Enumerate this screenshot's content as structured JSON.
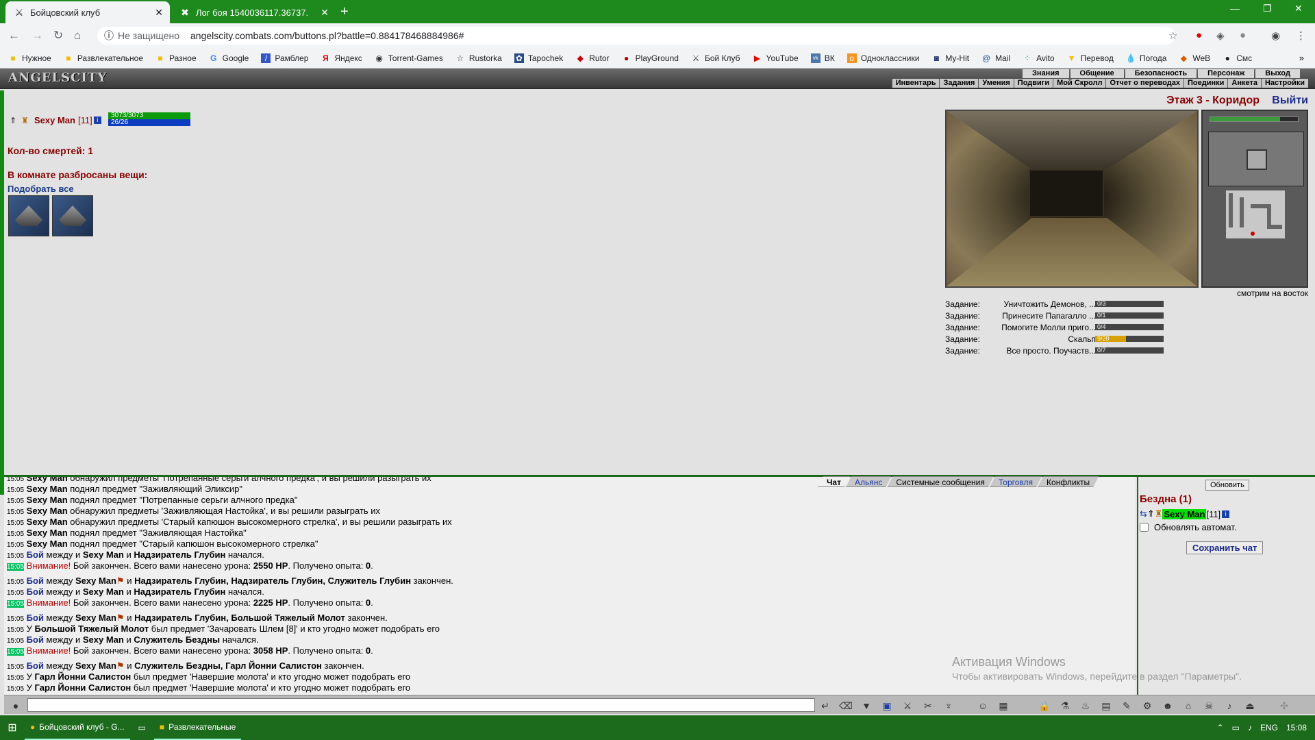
{
  "browser": {
    "tabs": [
      {
        "title": "Бойцовский клуб",
        "icon": "swords-icon"
      },
      {
        "title": "Лог боя 1540036117.36737.",
        "icon": "crossed-swords-icon"
      }
    ],
    "address": {
      "security": "Не защищено",
      "url": "angelscity.combats.com/buttons.pl?battle=0.884178468884986#"
    },
    "bookmarks": [
      "Нужное",
      "Развлекательное",
      "Разное",
      "Google",
      "Рамблер",
      "Яндекс",
      "Torrent-Games",
      "Rustorka",
      "Tapochek",
      "Rutor",
      "PlayGround",
      "Бой Клуб",
      "YouTube",
      "ВК",
      "Одноклассники",
      "My-Hit",
      "Mail",
      "Avito",
      "Перевод",
      "Погода",
      "WeB",
      "Смс"
    ]
  },
  "game": {
    "logo": "ANGELSCITY",
    "top_menu": [
      "Знания",
      "Общение",
      "Безопасность",
      "Персонаж",
      "Выход"
    ],
    "sub_menu": [
      "Инвентарь",
      "Задания",
      "Умения",
      "Подвиги",
      "Мой Скролл",
      "Отчет о переводах",
      "Поединки",
      "Анкета",
      "Настройки"
    ],
    "character": {
      "name": "Sexy Man",
      "level": "[11]",
      "hp": "3073/3073",
      "mana": "26/26"
    },
    "deaths": "Кол-во смертей: 1",
    "scattered": "В комнате разбросаны вещи:",
    "pick_all": "Подобрать все",
    "location": "Этаж 3 - Коридор",
    "exit": "Выйти",
    "looking": "смотрим на восток",
    "quests": [
      {
        "label": "Задание:",
        "name": "Уничтожить Демонов, ...",
        "progress": "0/3",
        "fraction": 0
      },
      {
        "label": "Задание:",
        "name": "Принесите Папагалло ...",
        "progress": "0/1",
        "fraction": 0
      },
      {
        "label": "Задание:",
        "name": "Помогите Молли приго...",
        "progress": "0/4",
        "fraction": 0
      },
      {
        "label": "Задание:",
        "name": "Скальп",
        "progress": "9/20",
        "fraction": 0.45
      },
      {
        "label": "Задание:",
        "name": "Все просто. Поучаств...",
        "progress": "0/7",
        "fraction": 0
      }
    ]
  },
  "chat": {
    "tabs": [
      "Чат",
      "Альянс",
      "Системные сообщения",
      "Торговля",
      "Конфликты"
    ],
    "refresh": "Обновить",
    "room": "Бездна (1)",
    "online_name": "Sexy Man",
    "online_level": "[11]",
    "auto_refresh": "Обновлять автомат.",
    "save_chat": "Сохранить чат"
  },
  "windows": {
    "watermark_title": "Активация Windows",
    "watermark_text": "Чтобы активировать Windows, перейдите в раздел \"Параметры\".",
    "taskbar_apps": [
      "Бойцовский клуб - G...",
      "Развлекательные"
    ],
    "lang": "ENG",
    "time": "15:08"
  }
}
